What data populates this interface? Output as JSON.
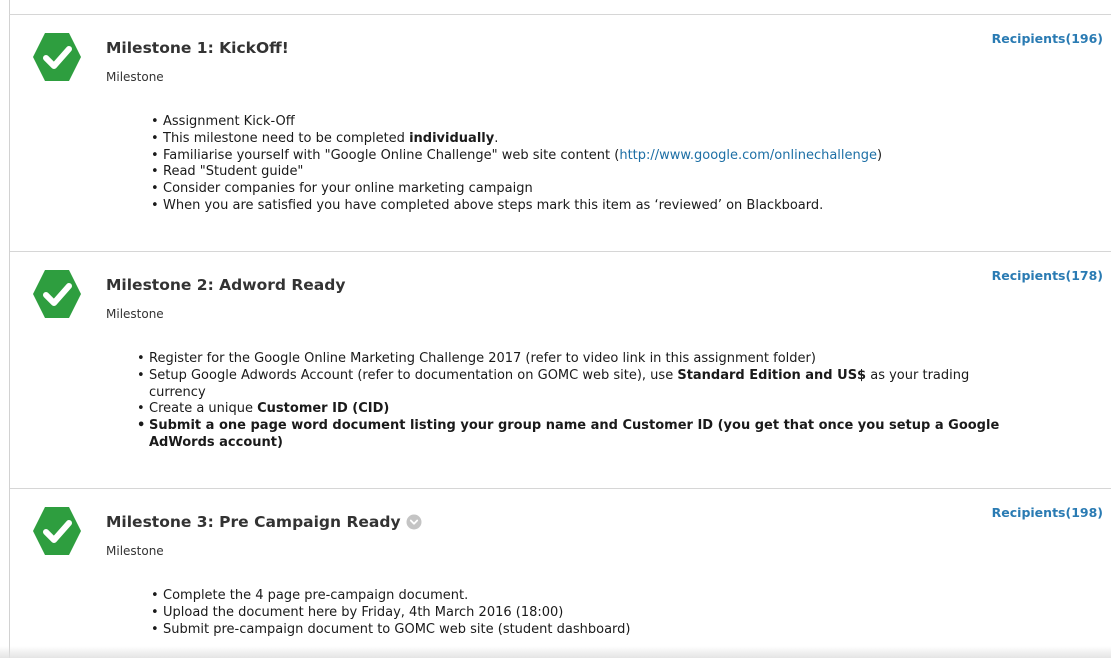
{
  "milestones": [
    {
      "title": "Milestone 1: KickOff!",
      "subtitle": "Milestone",
      "recipients": "Recipients(196)",
      "items": {
        "i0": "Assignment Kick-Off",
        "i1_a": "This milestone need to be completed ",
        "i1_b": "individually",
        "i1_c": ".",
        "i2_a": "Familiarise yourself with \"Google Online Challenge\" web site content (",
        "i2_link": "http://www.google.com/onlinechallenge",
        "i2_c": ")",
        "i3": "Read \"Student guide\"",
        "i4": "Consider companies for your online marketing campaign",
        "i5": "When you are satisfied you have completed above steps mark this item as ‘reviewed’ on Blackboard."
      }
    },
    {
      "title": "Milestone 2: Adword Ready",
      "subtitle": "Milestone",
      "recipients": "Recipients(178)",
      "items": {
        "i0": "Register for the Google Online Marketing Challenge 2017 (refer to video link in this assignment folder)",
        "i1_a": "Setup Google Adwords Account (refer to documentation on GOMC web site), use ",
        "i1_b": "Standard Edition and US$",
        "i1_c": " as your trading currency",
        "i2_a": "Create a unique ",
        "i2_b": "Customer ID (CID)",
        "i3": "Submit a one page word document listing your group name and Customer ID (you get that once you setup a Google AdWords account)"
      }
    },
    {
      "title": "Milestone 3: Pre Campaign Ready",
      "subtitle": "Milestone",
      "recipients": "Recipients(198)",
      "items": {
        "i0": "Complete the 4 page pre-campaign document.",
        "i1": "Upload the document here by Friday, 4th March 2016 (18:00)",
        "i2": "Submit pre-campaign document to GOMC web site (student dashboard)"
      }
    }
  ],
  "icons": {
    "completed": "checkmark-hexagon-icon",
    "info": "chevron-down-circle-icon"
  },
  "colors": {
    "check_green": "#2e9e3f",
    "link_blue": "#1d6fa5",
    "recipients_blue": "#2a7bb3"
  }
}
